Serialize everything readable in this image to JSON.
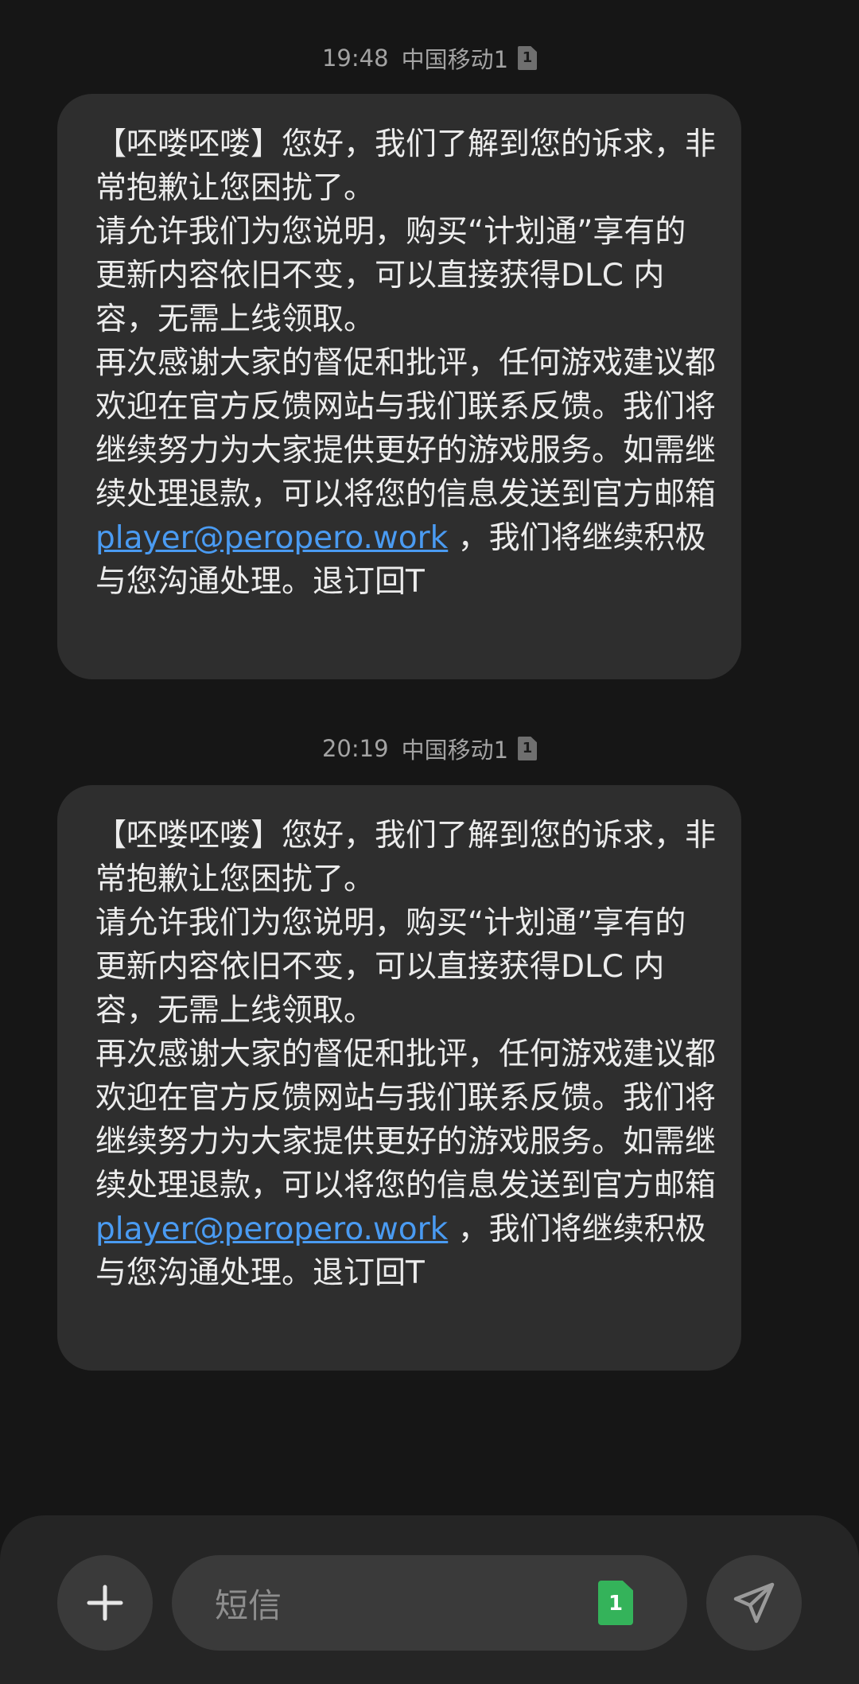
{
  "messages": [
    {
      "time": "19:48",
      "carrier": "中国移动1",
      "sim": "1",
      "body_before_link": "【呸喽呸喽】您好，我们了解到您的诉求，非常抱歉让您困扰了。\n请允许我们为您说明，购买“计划通”享有的更新内容依旧不变，可以直接获得DLC 内容，无需上线领取。\n再次感谢大家的督促和批评，任何游戏建议都欢迎在官方反馈网站与我们联系反馈。我们将继续努力为大家提供更好的游戏服务。如需继续处理退款，可以将您的信息发送到官方邮箱\n",
      "email": "player@peropero.work",
      "body_after_link": " ，我们将继续积极与您沟通处理。退订回T"
    },
    {
      "time": "20:19",
      "carrier": "中国移动1",
      "sim": "1",
      "body_before_link": "【呸喽呸喽】您好，我们了解到您的诉求，非常抱歉让您困扰了。\n请允许我们为您说明，购买“计划通”享有的更新内容依旧不变，可以直接获得DLC 内容，无需上线领取。\n再次感谢大家的督促和批评，任何游戏建议都欢迎在官方反馈网站与我们联系反馈。我们将继续努力为大家提供更好的游戏服务。如需继续处理退款，可以将您的信息发送到官方邮箱\n",
      "email": "player@peropero.work",
      "body_after_link": " ，我们将继续积极与您沟通处理。退订回T"
    }
  ],
  "composer": {
    "placeholder": "短信",
    "sim_label": "1",
    "plus_icon": "plus-icon",
    "send_icon": "send-icon"
  },
  "colors": {
    "background": "#161616",
    "bubble": "#2e2e2e",
    "link": "#4a9bf2",
    "sim_chip": "#34b35a"
  }
}
